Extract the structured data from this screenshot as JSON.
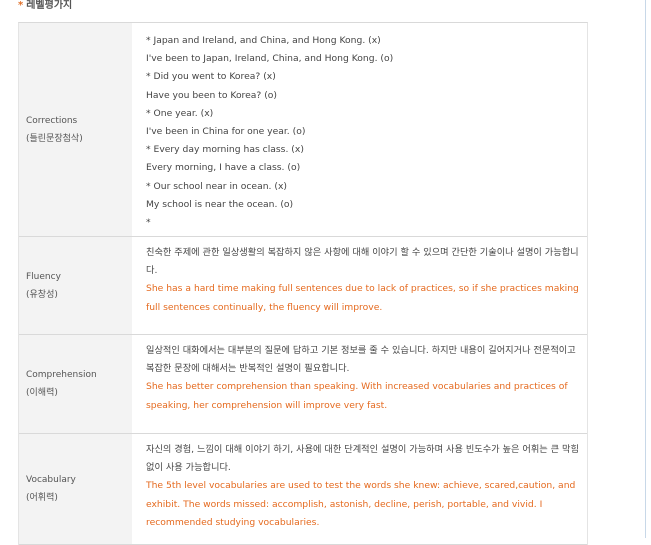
{
  "section": {
    "heading": "레벨평가지",
    "bullet": "*"
  },
  "rows": {
    "corrections": {
      "label_en": "Corrections",
      "label_ko": "(틀린문장첨삭)",
      "lines": [
        "* Japan and Ireland, and China, and Hong Kong. (x)",
        "I've been to Japan, Ireland, China, and Hong Kong. (o)",
        "* Did you went to Korea? (x)",
        "Have you been to Korea? (o)",
        "* One year. (x)",
        "I've been in China for one year. (o)",
        "* Every day morning has class. (x)",
        "Every morning, I have a class. (o)",
        "* Our school near in ocean. (x)",
        "My school is near the ocean. (o)",
        "*"
      ]
    },
    "fluency": {
      "label_en": "Fluency",
      "label_ko": "(유창성)",
      "description": "친숙한 주제에 관한 일상생활의 복잡하지 않은 사항에 대해 이야기 할 수 있으며 간단한 기술이나 설명이 가능합니다.",
      "feedback": "She has a hard time making full sentences due to lack of practices, so if she practices making full sentences continually, the fluency will improve."
    },
    "comprehension": {
      "label_en": "Comprehension",
      "label_ko": "(이해력)",
      "description": "일상적인 대화에서는 대부분의 질문에 답하고 기본 정보를 줄 수 있습니다. 하지만 내용이 길어지거나 전문적이고 복잡한 문장에 대해서는 반복적인 설명이 필요합니다.",
      "feedback": "She has better comprehension than speaking. With increased vocabularies and practices of speaking, her comprehension will improve very fast."
    },
    "vocabulary": {
      "label_en": "Vocabulary",
      "label_ko": "(어휘력)",
      "description": "자신의 경험, 느낌이 대해 이야기 하기, 사용에 대한 단계적인 설명이 가능하며 사용 빈도수가 높은 어휘는 큰 막힘없이 사용 가능합니다.",
      "feedback": "The 5th level vocabularies are used to test the words she knew: achieve, scared,caution, and exhibit. The words missed: accomplish, astonish, decline, perish, portable, and vivid. I recommended studying vocabularies."
    }
  },
  "colors": {
    "feedback": "#e56a1f",
    "label_bg": "#f3f3f3",
    "border": "#d9d9d9",
    "accent": "#e0702a"
  }
}
